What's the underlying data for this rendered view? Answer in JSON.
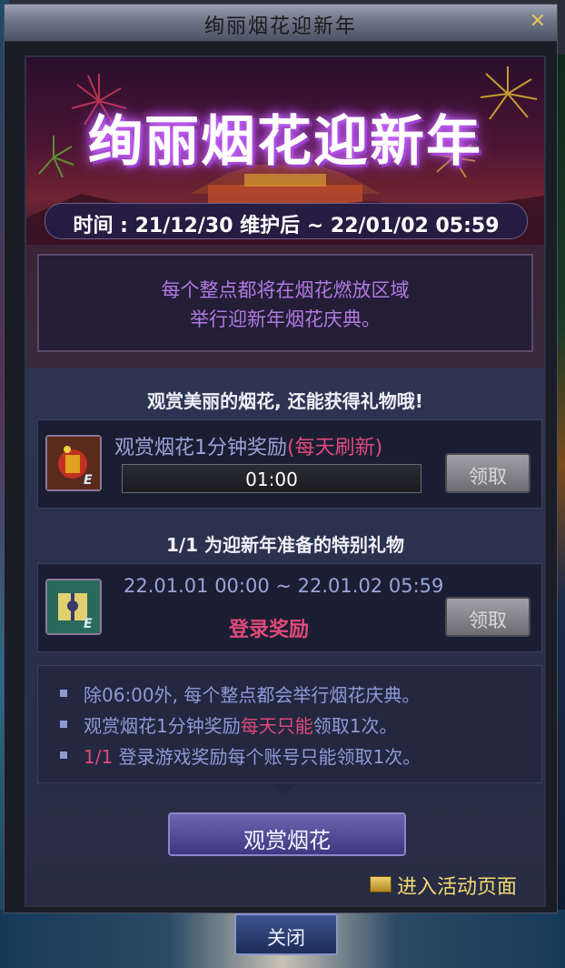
{
  "window": {
    "title": "绚丽烟花迎新年",
    "close_glyph": "✕"
  },
  "banner": {
    "title": "绚丽烟花迎新年",
    "date_range": "时间 : 21/12/30 维护后 ~ 22/01/02 05:59"
  },
  "description": {
    "line1": "每个整点都将在烟花燃放区域",
    "line2": "举行迎新年烟花庆典。"
  },
  "section1": {
    "heading": "观赏美丽的烟花, 还能获得礼物哦!"
  },
  "reward1": {
    "title": "观赏烟花1分钟奖励",
    "title_highlight": "(每天刷新)",
    "timer": "01:00",
    "claim_label": "领取",
    "icon": "firework-cracker-icon"
  },
  "section2": {
    "heading": "1/1  为迎新年准备的特别礼物"
  },
  "reward2": {
    "date_range": "22.01.01 00:00 ~ 22.01.02 05:59",
    "label": "登录奖励",
    "claim_label": "领取",
    "icon": "gift-box-icon"
  },
  "notes": [
    {
      "plain": "除06:00外, 每个整点都会举行烟花庆典。"
    },
    {
      "plain": "观赏烟花1分钟奖励",
      "pink": "每天只能",
      "suffix": "领取1次。"
    },
    {
      "pink": "1/1",
      "plain": " 登录游戏奖励每个账号只能领取1次。"
    }
  ],
  "buttons": {
    "watch_label": "观赏烟花",
    "enter_label": "进入活动页面",
    "close_label": "关闭"
  },
  "colors": {
    "highlight_pink": "#e04a7a",
    "note_text": "#8f9ad8",
    "link_gold": "#f0d870"
  }
}
